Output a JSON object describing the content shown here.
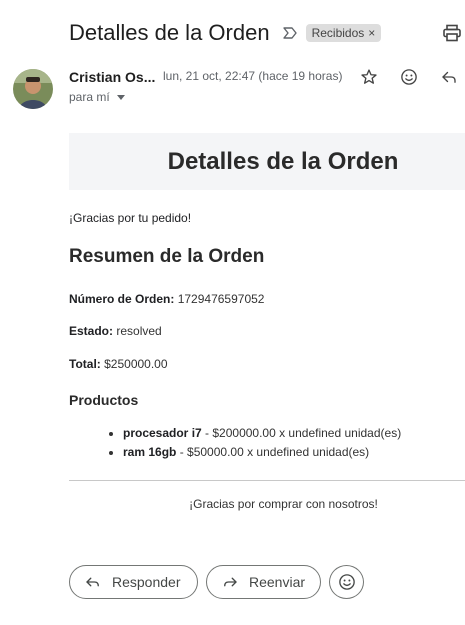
{
  "header": {
    "subject": "Detalles de la Orden",
    "label_chip": "Recibidos",
    "label_remove": "×"
  },
  "message": {
    "sender_name": "Cristian Os...",
    "date": "lun, 21 oct, 22:47 (hace 19 horas)",
    "recipient": "para mí"
  },
  "email_body": {
    "banner_title": "Detalles de la Orden",
    "thanks": "¡Gracias por tu pedido!",
    "summary_title": "Resumen de la Orden",
    "order_number_label": "Número de Orden:",
    "order_number_value": "1729476597052",
    "status_label": "Estado:",
    "status_value": "resolved",
    "total_label": "Total:",
    "total_value": "$250000.00",
    "products_title": "Productos",
    "products": [
      {
        "name": "procesador i7",
        "detail": " - $200000.00 x undefined unidad(es)"
      },
      {
        "name": "ram 16gb",
        "detail": " - $50000.00 x undefined unidad(es)"
      }
    ],
    "footer": "¡Gracias por comprar con nosotros!"
  },
  "actions": {
    "reply_label": "Responder",
    "forward_label": "Reenviar"
  },
  "icons": {
    "importance": "importance-marker-icon",
    "print": "print-icon",
    "star": "star-icon",
    "emoji": "emoji-icon",
    "reply": "reply-icon",
    "forward": "forward-icon",
    "caret": "caret-down-icon",
    "avatar": "sender-avatar"
  },
  "colors": {
    "banner_bg": "#f4f5f7",
    "chip_bg": "#dddddd",
    "text_primary": "#202124",
    "text_secondary": "#5f6368"
  }
}
